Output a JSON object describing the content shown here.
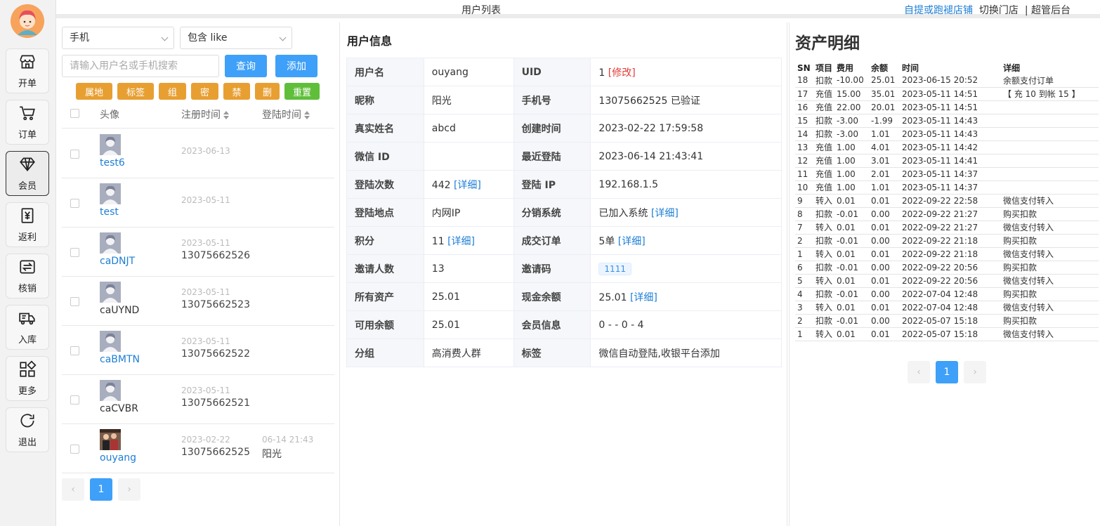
{
  "nav": {
    "items": [
      {
        "label": "开单",
        "icon": "store-icon"
      },
      {
        "label": "订单",
        "icon": "cart-icon"
      },
      {
        "label": "会员",
        "icon": "diamond-icon",
        "active": true
      },
      {
        "label": "返利",
        "icon": "yuan-receipt-icon"
      },
      {
        "label": "核销",
        "icon": "exchange-icon"
      },
      {
        "label": "入库",
        "icon": "truck-icon"
      },
      {
        "label": "更多",
        "icon": "grid-icon"
      },
      {
        "label": "退出",
        "icon": "refresh-icon"
      }
    ]
  },
  "topbar": {
    "title": "用户列表",
    "store_link": "自提或跑褪店铺",
    "switch_store": "切换门店",
    "admin": "| 超管后台"
  },
  "list": {
    "field_select": "手机",
    "match_select": "包含 like",
    "search_placeholder": "请输入用户名或手机搜索",
    "query_label": "查询",
    "add_label": "添加",
    "tag_buttons": [
      "属地",
      "标签",
      "组",
      "密",
      "禁",
      "删",
      "重置"
    ],
    "headers": {
      "avatar": "头像",
      "reg_time": "注册时间",
      "login_time": "登陆时间"
    },
    "rows": [
      {
        "name": "test6",
        "linked": true,
        "reg": "2023-06-13",
        "phone": "",
        "login": "",
        "nick": ""
      },
      {
        "name": "test",
        "linked": true,
        "reg": "2023-05-11",
        "phone": "",
        "login": "",
        "nick": ""
      },
      {
        "name": "caDNJT",
        "linked": true,
        "reg": "2023-05-11",
        "phone": "13075662526",
        "login": "",
        "nick": ""
      },
      {
        "name": "caUYND",
        "linked": false,
        "reg": "2023-05-11",
        "phone": "13075662523",
        "login": "",
        "nick": ""
      },
      {
        "name": "caBMTN",
        "linked": true,
        "reg": "2023-05-11",
        "phone": "13075662522",
        "login": "",
        "nick": ""
      },
      {
        "name": "caCVBR",
        "linked": false,
        "reg": "2023-05-11",
        "phone": "13075662521",
        "login": "",
        "nick": ""
      },
      {
        "name": "ouyang",
        "linked": true,
        "reg": "2023-02-22",
        "phone": "13075662525",
        "login": "06-14 21:43",
        "nick": "阳光",
        "photo": true
      }
    ],
    "page": {
      "prev": "‹",
      "current": "1",
      "next": "›"
    }
  },
  "info": {
    "title": "用户信息",
    "rows": [
      [
        {
          "k": "用户名",
          "v": "ouyang"
        },
        {
          "k": "UID",
          "v": "1",
          "extra": "[修改]",
          "extra_type": "red"
        }
      ],
      [
        {
          "k": "昵称",
          "v": "阳光"
        },
        {
          "k": "手机号",
          "v": "13075662525 已验证"
        }
      ],
      [
        {
          "k": "真实姓名",
          "v": "abcd"
        },
        {
          "k": "创建时间",
          "v": "2023-02-22 17:59:58"
        }
      ],
      [
        {
          "k": "微信 ID",
          "v": ""
        },
        {
          "k": "最近登陆",
          "v": "2023-06-14 21:43:41"
        }
      ],
      [
        {
          "k": "登陆次数",
          "v": "442",
          "extra": "[详细]",
          "extra_type": "link"
        },
        {
          "k": "登陆 IP",
          "v": "192.168.1.5"
        }
      ],
      [
        {
          "k": "登陆地点",
          "v": "内网IP"
        },
        {
          "k": "分销系统",
          "v": "已加入系统",
          "extra": "[详细]",
          "extra_type": "link"
        }
      ],
      [
        {
          "k": "积分",
          "v": "11",
          "extra": "[详细]",
          "extra_type": "link"
        },
        {
          "k": "成交订单",
          "v": "5单",
          "extra": "[详细]",
          "extra_type": "link"
        }
      ],
      [
        {
          "k": "邀请人数",
          "v": "13"
        },
        {
          "k": "邀请码",
          "v": "",
          "badge": "1111"
        }
      ],
      [
        {
          "k": "所有资产",
          "v": "25.01"
        },
        {
          "k": "现金余额",
          "v": "25.01",
          "extra": "[详细]",
          "extra_type": "link"
        }
      ],
      [
        {
          "k": "可用余额",
          "v": "25.01"
        },
        {
          "k": "会员信息",
          "v": "0 - - 0 - 4"
        }
      ],
      [
        {
          "k": "分组",
          "v": "高消费人群"
        },
        {
          "k": "标签",
          "v": "微信自动登陆,收银平台添加"
        }
      ]
    ]
  },
  "assets": {
    "title": "资产明细",
    "headers": [
      "SN",
      "项目",
      "费用",
      "余额",
      "时间",
      "详细"
    ],
    "rows": [
      [
        "18",
        "扣款",
        "-10.00",
        "25.01",
        "2023-06-15 20:52",
        "余额支付订单"
      ],
      [
        "17",
        "充值",
        "15.00",
        "35.01",
        "2023-05-11 14:51",
        "【 充 10 到帐 15 】"
      ],
      [
        "16",
        "充值",
        "22.00",
        "20.01",
        "2023-05-11 14:51",
        ""
      ],
      [
        "15",
        "扣款",
        "-3.00",
        "-1.99",
        "2023-05-11 14:43",
        ""
      ],
      [
        "14",
        "扣款",
        "-3.00",
        "1.01",
        "2023-05-11 14:43",
        ""
      ],
      [
        "13",
        "充值",
        "1.00",
        "4.01",
        "2023-05-11 14:42",
        ""
      ],
      [
        "12",
        "充值",
        "1.00",
        "3.01",
        "2023-05-11 14:41",
        ""
      ],
      [
        "11",
        "充值",
        "1.00",
        "2.01",
        "2023-05-11 14:37",
        ""
      ],
      [
        "10",
        "充值",
        "1.00",
        "1.01",
        "2023-05-11 14:37",
        ""
      ],
      [
        "9",
        "转入",
        "0.01",
        "0.01",
        "2022-09-22 22:58",
        "微信支付转入"
      ],
      [
        "8",
        "扣款",
        "-0.01",
        "0.00",
        "2022-09-22 21:27",
        "购买扣款"
      ],
      [
        "7",
        "转入",
        "0.01",
        "0.01",
        "2022-09-22 21:27",
        "微信支付转入"
      ],
      [
        "2",
        "扣款",
        "-0.01",
        "0.00",
        "2022-09-22 21:18",
        "购买扣款"
      ],
      [
        "1",
        "转入",
        "0.01",
        "0.01",
        "2022-09-22 21:18",
        "微信支付转入"
      ],
      [
        "6",
        "扣款",
        "-0.01",
        "0.00",
        "2022-09-22 20:56",
        "购买扣款"
      ],
      [
        "5",
        "转入",
        "0.01",
        "0.01",
        "2022-09-22 20:56",
        "微信支付转入"
      ],
      [
        "4",
        "扣款",
        "-0.01",
        "0.00",
        "2022-07-04 12:48",
        "购买扣款"
      ],
      [
        "3",
        "转入",
        "0.01",
        "0.01",
        "2022-07-04 12:48",
        "微信支付转入"
      ],
      [
        "2",
        "扣款",
        "-0.01",
        "0.00",
        "2022-05-07 15:18",
        "购买扣款"
      ],
      [
        "1",
        "转入",
        "0.01",
        "0.01",
        "2022-05-07 15:18",
        "微信支付转入"
      ]
    ],
    "page": {
      "prev": "‹",
      "current": "1",
      "next": "›"
    }
  }
}
